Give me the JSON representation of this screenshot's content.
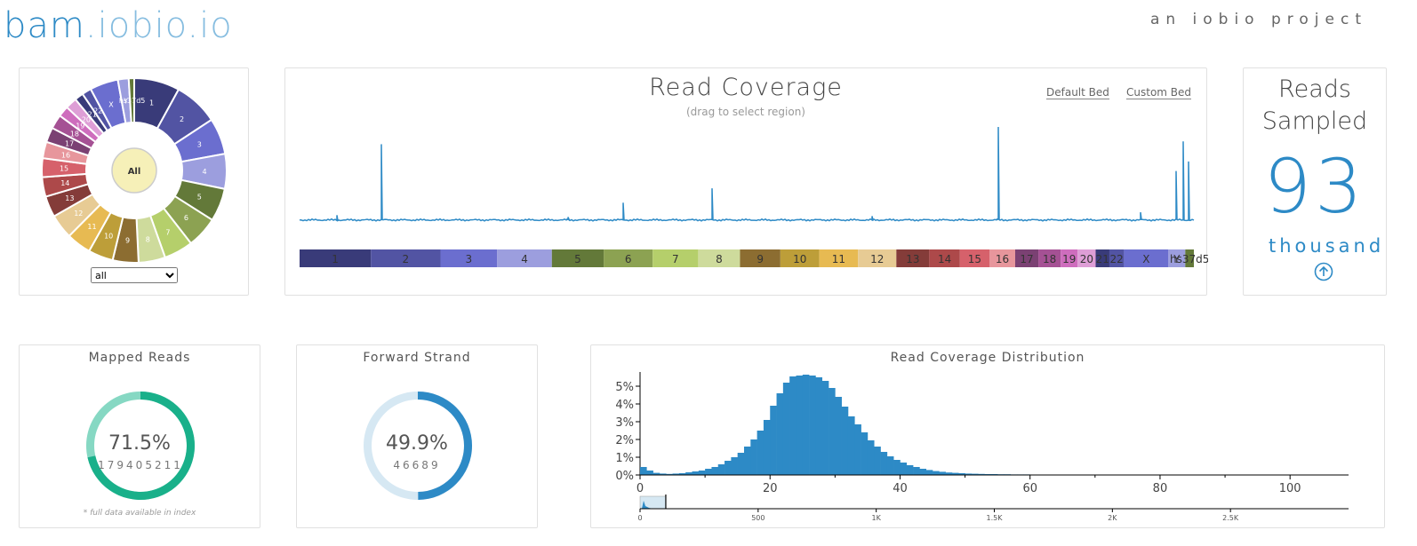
{
  "header": {
    "brand_main": "bam",
    "brand_ext": ".iobio.io",
    "tagline": "an iobio project"
  },
  "colors": {
    "accent": "#2d8ac6",
    "light_accent": "#d6e8f3",
    "mapped": "#19b08a",
    "mapped_light": "#86d8c3"
  },
  "chrom_picker": {
    "center_label": "All",
    "select_value": "all",
    "select_options": [
      "all"
    ],
    "segments": [
      {
        "label": "1",
        "color": "#393b79"
      },
      {
        "label": "2",
        "color": "#5254a3"
      },
      {
        "label": "3",
        "color": "#6b6ecf"
      },
      {
        "label": "4",
        "color": "#9c9ede"
      },
      {
        "label": "5",
        "color": "#637939"
      },
      {
        "label": "6",
        "color": "#8ca252"
      },
      {
        "label": "7",
        "color": "#b5cf6b"
      },
      {
        "label": "8",
        "color": "#cedb9c"
      },
      {
        "label": "9",
        "color": "#8c6d31"
      },
      {
        "label": "10",
        "color": "#bd9e39"
      },
      {
        "label": "11",
        "color": "#e7ba52"
      },
      {
        "label": "12",
        "color": "#e7cb94"
      },
      {
        "label": "13",
        "color": "#843c39"
      },
      {
        "label": "14",
        "color": "#ad494a"
      },
      {
        "label": "15",
        "color": "#d6616b"
      },
      {
        "label": "16",
        "color": "#e7969c"
      },
      {
        "label": "17",
        "color": "#7b4173"
      },
      {
        "label": "18",
        "color": "#a55194"
      },
      {
        "label": "19",
        "color": "#ce6dbd"
      },
      {
        "label": "20",
        "color": "#de9ed6"
      },
      {
        "label": "21",
        "color": "#393b79"
      },
      {
        "label": "22",
        "color": "#5254a3"
      },
      {
        "label": "X",
        "color": "#6b6ecf"
      },
      {
        "label": "Y",
        "color": "#9c9ede"
      },
      {
        "label": "hs37d5",
        "color": "#637939"
      }
    ]
  },
  "coverage": {
    "title": "Read Coverage",
    "subtitle": "(drag to select region)",
    "default_bed": "Default Bed",
    "custom_bed": "Custom Bed"
  },
  "reads_sampled": {
    "title_line1": "Reads",
    "title_line2": "Sampled",
    "value": "93",
    "unit": "thousand",
    "more_icon": "arrow-up-circle-icon"
  },
  "mapped_reads": {
    "title": "Mapped Reads",
    "percent": "71.5%",
    "count": "179405211",
    "fraction": 0.715,
    "note": "* full data available in index"
  },
  "forward_strand": {
    "title": "Forward Strand",
    "percent": "49.9%",
    "count": "46689",
    "fraction": 0.499
  },
  "chart_data": [
    {
      "type": "line",
      "title": "Read Coverage",
      "subtitle": "(drag to select region)",
      "baseline": 0.03,
      "spikes": [
        {
          "x": 0.04,
          "y": 0.08
        },
        {
          "x": 0.09,
          "y": 0.82
        },
        {
          "x": 0.3,
          "y": 0.06
        },
        {
          "x": 0.36,
          "y": 0.21
        },
        {
          "x": 0.46,
          "y": 0.36
        },
        {
          "x": 0.64,
          "y": 0.07
        },
        {
          "x": 0.78,
          "y": 1.0
        },
        {
          "x": 0.94,
          "y": 0.11
        },
        {
          "x": 0.98,
          "y": 0.54
        },
        {
          "x": 0.988,
          "y": 0.85
        },
        {
          "x": 0.993,
          "y": 0.64
        }
      ],
      "chromosome_bar": [
        {
          "label": "1",
          "color": "#393b79",
          "length": 249
        },
        {
          "label": "2",
          "color": "#5254a3",
          "length": 243
        },
        {
          "label": "3",
          "color": "#6b6ecf",
          "length": 198
        },
        {
          "label": "4",
          "color": "#9c9ede",
          "length": 191
        },
        {
          "label": "5",
          "color": "#637939",
          "length": 181
        },
        {
          "label": "6",
          "color": "#8ca252",
          "length": 171
        },
        {
          "label": "7",
          "color": "#b5cf6b",
          "length": 159
        },
        {
          "label": "8",
          "color": "#cedb9c",
          "length": 146
        },
        {
          "label": "9",
          "color": "#8c6d31",
          "length": 141
        },
        {
          "label": "10",
          "color": "#bd9e39",
          "length": 136
        },
        {
          "label": "11",
          "color": "#e7ba52",
          "length": 135
        },
        {
          "label": "12",
          "color": "#e7cb94",
          "length": 134
        },
        {
          "label": "13",
          "color": "#843c39",
          "length": 115
        },
        {
          "label": "14",
          "color": "#ad494a",
          "length": 107
        },
        {
          "label": "15",
          "color": "#d6616b",
          "length": 103
        },
        {
          "label": "16",
          "color": "#e7969c",
          "length": 90
        },
        {
          "label": "17",
          "color": "#7b4173",
          "length": 81
        },
        {
          "label": "18",
          "color": "#a55194",
          "length": 78
        },
        {
          "label": "19",
          "color": "#ce6dbd",
          "length": 59
        },
        {
          "label": "20",
          "color": "#de9ed6",
          "length": 63
        },
        {
          "label": "21",
          "color": "#393b79",
          "length": 48
        },
        {
          "label": "22",
          "color": "#5254a3",
          "length": 51
        },
        {
          "label": "X",
          "color": "#6b6ecf",
          "length": 155
        },
        {
          "label": "Y",
          "color": "#9c9ede",
          "length": 59
        },
        {
          "label": "hs37d5",
          "color": "#637939",
          "length": 30
        }
      ]
    },
    {
      "type": "bar",
      "title": "Read Coverage Distribution",
      "xlabel": "",
      "ylabel": "",
      "xlim": [
        0,
        109
      ],
      "ylim": [
        0,
        5.8
      ],
      "x_ticks": [
        0,
        20,
        40,
        60,
        80,
        100
      ],
      "y_ticks": [
        "0%",
        "1%",
        "2%",
        "3%",
        "4%",
        "5%"
      ],
      "x": [
        0,
        1,
        2,
        3,
        4,
        5,
        6,
        7,
        8,
        9,
        10,
        11,
        12,
        13,
        14,
        15,
        16,
        17,
        18,
        19,
        20,
        21,
        22,
        23,
        24,
        25,
        26,
        27,
        28,
        29,
        30,
        31,
        32,
        33,
        34,
        35,
        36,
        37,
        38,
        39,
        40,
        41,
        42,
        43,
        44,
        45,
        46,
        47,
        48,
        49,
        50,
        51,
        52,
        53,
        54,
        55,
        56,
        57,
        58,
        59,
        60,
        61,
        62,
        63,
        64,
        65,
        66,
        67,
        68,
        69,
        70,
        71,
        72,
        73,
        74,
        75,
        76,
        77,
        78,
        79,
        80
      ],
      "values": [
        0.45,
        0.25,
        0.12,
        0.08,
        0.06,
        0.08,
        0.1,
        0.15,
        0.2,
        0.25,
        0.35,
        0.45,
        0.6,
        0.8,
        1.0,
        1.25,
        1.6,
        2.0,
        2.5,
        3.1,
        3.9,
        4.6,
        5.2,
        5.55,
        5.6,
        5.65,
        5.6,
        5.5,
        5.3,
        4.9,
        4.4,
        3.85,
        3.3,
        2.85,
        2.4,
        1.95,
        1.6,
        1.3,
        1.05,
        0.85,
        0.7,
        0.55,
        0.45,
        0.35,
        0.28,
        0.22,
        0.18,
        0.14,
        0.12,
        0.1,
        0.08,
        0.07,
        0.06,
        0.05,
        0.05,
        0.04,
        0.04,
        0.03,
        0.03,
        0.03,
        0.02,
        0.02,
        0.02,
        0.02,
        0.02,
        0.02,
        0.01,
        0.01,
        0.01,
        0.01,
        0.01,
        0.01,
        0.01,
        0.01,
        0.01,
        0.01,
        0.01,
        0.01,
        0.01,
        0.01,
        0.01
      ],
      "brush_axis": {
        "ticks": [
          "0",
          "500",
          "1K",
          "1.5K",
          "2K",
          "2.5K"
        ],
        "tick_values": [
          0,
          500,
          1000,
          1500,
          2000,
          2500
        ],
        "max": 3000,
        "selected": [
          0,
          109
        ]
      }
    }
  ]
}
